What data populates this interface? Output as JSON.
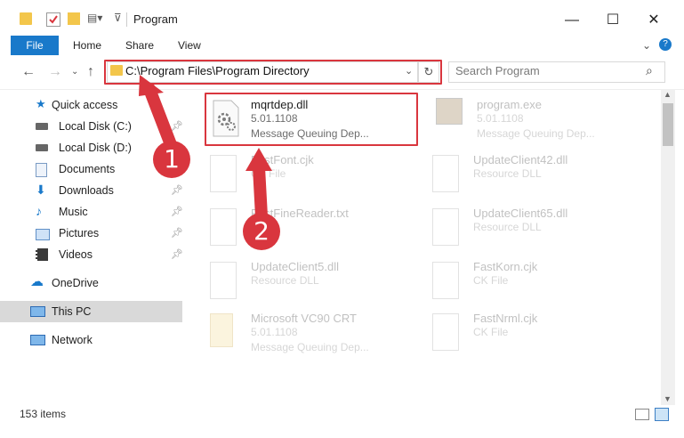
{
  "window": {
    "title": "Program"
  },
  "ribbon": {
    "file": "File",
    "home": "Home",
    "share": "Share",
    "view": "View"
  },
  "address": {
    "path": "C:\\Program Files\\Program Directory"
  },
  "search": {
    "placeholder": "Search Program"
  },
  "sidebar": {
    "items": [
      {
        "label": "Quick access"
      },
      {
        "label": "Local Disk (C:)"
      },
      {
        "label": "Local Disk (D:)"
      },
      {
        "label": "Documents"
      },
      {
        "label": "Downloads"
      },
      {
        "label": "Music"
      },
      {
        "label": "Pictures"
      },
      {
        "label": "Videos"
      },
      {
        "label": "OneDrive"
      },
      {
        "label": "This PC"
      },
      {
        "label": "Network"
      }
    ]
  },
  "files": [
    {
      "name": "mqrtdep.dll",
      "line1": "5.01.1108",
      "line2": "Message Queuing Dep..."
    },
    {
      "name": "program.exe",
      "line1": "5.01.1108",
      "line2": "Message Queuing Dep..."
    },
    {
      "name": "FastFont.cjk",
      "line1": "CK File"
    },
    {
      "name": "UpdateClient42.dll",
      "line1": "Resource DLL"
    },
    {
      "name": "FastFineReader.txt",
      "line1": ""
    },
    {
      "name": "UpdateClient65.dll",
      "line1": "Resource DLL"
    },
    {
      "name": "UpdateClient5.dll",
      "line1": "Resource DLL"
    },
    {
      "name": "FastKorn.cjk",
      "line1": "CK File"
    },
    {
      "name": "Microsoft VC90 CRT",
      "line1": "5.01.1108",
      "line2": "Message Queuing Dep..."
    },
    {
      "name": "FastNrml.cjk",
      "line1": "CK File"
    }
  ],
  "status": {
    "count": "153 items"
  },
  "annotations": {
    "step1": "1",
    "step2": "2"
  },
  "colors": {
    "accent": "#1979ca",
    "highlight": "#d9363e"
  }
}
